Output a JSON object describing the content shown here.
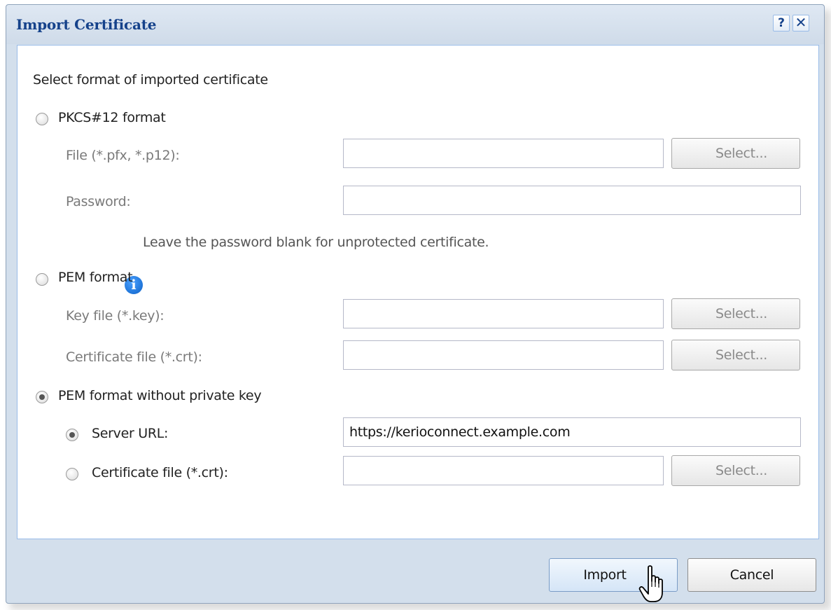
{
  "dialog": {
    "title": "Import Certificate",
    "help_label": "?",
    "close_label": "✕"
  },
  "form": {
    "heading": "Select format of imported certificate",
    "pkcs12": {
      "label": "PKCS#12 format",
      "checked": false,
      "file_label": "File (*.pfx, *.p12):",
      "file_value": "",
      "password_label": "Password:",
      "password_value": "",
      "select_label": "Select...",
      "info_text": "Leave the password blank for unprotected certificate."
    },
    "pem": {
      "label": "PEM format",
      "checked": false,
      "key_label": "Key file (*.key):",
      "key_value": "",
      "cert_label": "Certificate file (*.crt):",
      "cert_value": "",
      "select_label": "Select..."
    },
    "pem_no_key": {
      "label": "PEM format without private key",
      "checked": true,
      "server_url_label": "Server URL:",
      "server_url_checked": true,
      "server_url_value": "https://kerioconnect.example.com",
      "cert_label": "Certificate file (*.crt):",
      "cert_checked": false,
      "cert_value": "",
      "select_label": "Select..."
    }
  },
  "footer": {
    "import_label": "Import",
    "cancel_label": "Cancel"
  },
  "colors": {
    "title": "#15428b",
    "dialog_frame": "#d3dfec",
    "panel_border": "#99bbe8",
    "info_icon": "#1e74d8"
  },
  "icons": {
    "info": "info-icon",
    "cursor": "hand-pointer-icon"
  }
}
